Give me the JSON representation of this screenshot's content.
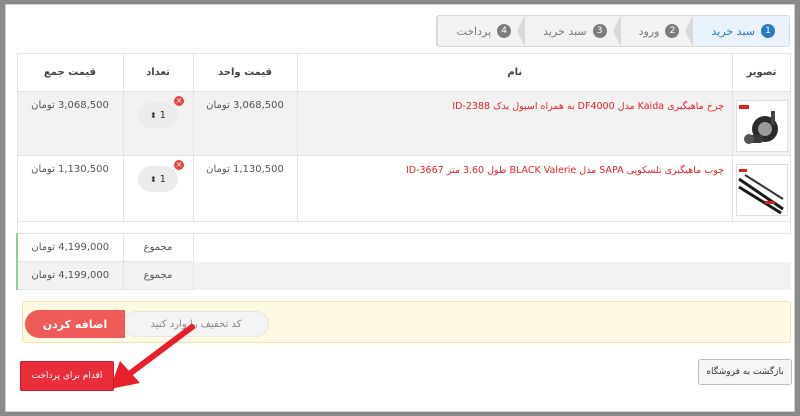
{
  "steps": [
    {
      "num": "1",
      "label": "سبد خرید",
      "active": true
    },
    {
      "num": "2",
      "label": "ورود",
      "active": false
    },
    {
      "num": "3",
      "label": "سبد خرید",
      "active": false
    },
    {
      "num": "4",
      "label": "پرداخت",
      "active": false
    }
  ],
  "table": {
    "headers": {
      "image": "تصویر",
      "name": "نام",
      "unit_price": "قیمت واحد",
      "qty": "تعداد",
      "total": "قیمت جمع"
    },
    "rows": [
      {
        "name": "چرخ ماهیگیری Kaida مدل DF4000 به همراه اسپول یدک ID-2388",
        "unit_price": "3,068,500 تومان",
        "qty": "1",
        "total": "3,068,500 تومان"
      },
      {
        "name": "چوب ماهیگیری تلسکوپی SAPA مدل BLACK Valerie طول 3.60 متر ID-3667",
        "unit_price": "1,130,500 تومان",
        "qty": "1",
        "total": "1,130,500 تومان"
      }
    ],
    "sums": [
      {
        "label": "مجموع",
        "value": "4,199,000 تومان"
      },
      {
        "label": "مجموع",
        "value": "4,199,000 تومان"
      }
    ]
  },
  "coupon": {
    "placeholder": "کد تخفیف را وارد کنید",
    "button": "اضافه کردن"
  },
  "actions": {
    "pay": "اقدام برای پرداخت",
    "back": "بازگشت به فروشگاه"
  },
  "colors": {
    "accent": "#2a7bc0",
    "product_link": "#e0262a",
    "pay_button": "#ea2e39",
    "annotation_arrow": "#e8202a"
  }
}
